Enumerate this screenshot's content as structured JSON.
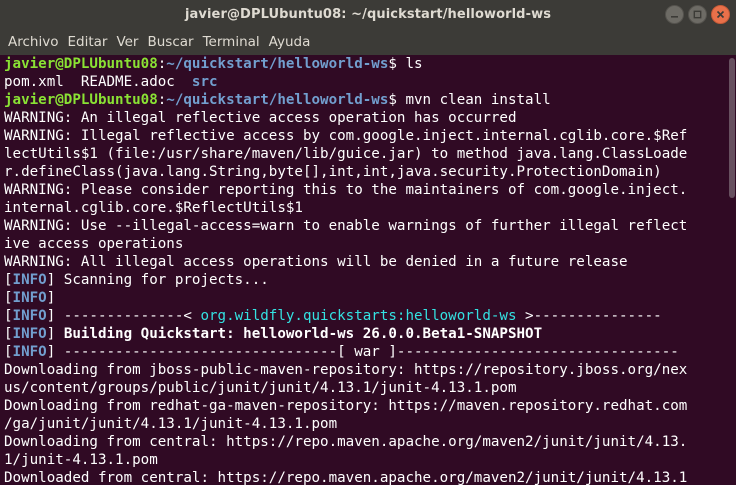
{
  "window": {
    "title": "javier@DPLUbuntu08: ~/quickstart/helloworld-ws",
    "controls": [
      "minimize-icon",
      "maximize-icon",
      "close-icon"
    ]
  },
  "menu": [
    "Archivo",
    "Editar",
    "Ver",
    "Buscar",
    "Terminal",
    "Ayuda"
  ],
  "colors": {
    "terminal_bg": "#300a24",
    "titlebar_bg": "#3c3b37",
    "prompt_user": "#8ae234",
    "prompt_path": "#729fcf",
    "info_tag": "#729fcf",
    "artifact": "#34e2e2",
    "close_button": "#e9704a"
  },
  "terminal": {
    "prompt_user": "javier@DPLUbuntu08",
    "prompt_path": "~/quickstart/helloworld-ws",
    "lines": [
      [
        [
          "user",
          "javier@DPLUbuntu08"
        ],
        [
          "",
          ":"
        ],
        [
          "path",
          "~/quickstart/helloworld-ws"
        ],
        [
          "",
          "$ ls"
        ]
      ],
      [
        [
          "",
          "pom.xml  README.adoc  "
        ],
        [
          "dir",
          "src"
        ]
      ],
      [
        [
          "user",
          "javier@DPLUbuntu08"
        ],
        [
          "",
          ":"
        ],
        [
          "path",
          "~/quickstart/helloworld-ws"
        ],
        [
          "",
          "$ mvn clean install"
        ]
      ],
      [
        [
          "",
          "WARNING: An illegal reflective access operation has occurred"
        ]
      ],
      [
        [
          "",
          "WARNING: Illegal reflective access by com.google.inject.internal.cglib.core.$Ref"
        ]
      ],
      [
        [
          "",
          "lectUtils$1 (file:/usr/share/maven/lib/guice.jar) to method java.lang.ClassLoade"
        ]
      ],
      [
        [
          "",
          "r.defineClass(java.lang.String,byte[],int,int,java.security.ProtectionDomain)"
        ]
      ],
      [
        [
          "",
          "WARNING: Please consider reporting this to the maintainers of com.google.inject."
        ]
      ],
      [
        [
          "",
          "internal.cglib.core.$ReflectUtils$1"
        ]
      ],
      [
        [
          "",
          "WARNING: Use --illegal-access=warn to enable warnings of further illegal reflect"
        ]
      ],
      [
        [
          "",
          "ive access operations"
        ]
      ],
      [
        [
          "",
          "WARNING: All illegal access operations will be denied in a future release"
        ]
      ],
      [
        [
          "",
          "["
        ],
        [
          "ib",
          "INFO"
        ],
        [
          "",
          "] Scanning for projects..."
        ]
      ],
      [
        [
          "",
          "["
        ],
        [
          "ib",
          "INFO"
        ],
        [
          "",
          "]"
        ]
      ],
      [
        [
          "",
          "["
        ],
        [
          "ib",
          "INFO"
        ],
        [
          "",
          "] --------------< "
        ],
        [
          "teal",
          "org.wildfly.quickstarts:helloworld-ws"
        ],
        [
          "",
          " >---------------"
        ]
      ],
      [
        [
          "",
          "["
        ],
        [
          "ib",
          "INFO"
        ],
        [
          "",
          "] "
        ],
        [
          "b",
          "Building Quickstart: helloworld-ws 26.0.0.Beta1-SNAPSHOT"
        ]
      ],
      [
        [
          "",
          "["
        ],
        [
          "ib",
          "INFO"
        ],
        [
          "",
          "] --------------------------------[ war ]---------------------------------"
        ]
      ],
      [
        [
          "",
          "Downloading from jboss-public-maven-repository: https://repository.jboss.org/nex"
        ]
      ],
      [
        [
          "",
          "us/content/groups/public/junit/junit/4.13.1/junit-4.13.1.pom"
        ]
      ],
      [
        [
          "",
          "Downloading from redhat-ga-maven-repository: https://maven.repository.redhat.com"
        ]
      ],
      [
        [
          "",
          "/ga/junit/junit/4.13.1/junit-4.13.1.pom"
        ]
      ],
      [
        [
          "",
          "Downloading from central: https://repo.maven.apache.org/maven2/junit/junit/4.13."
        ]
      ],
      [
        [
          "",
          "1/junit-4.13.1.pom"
        ]
      ],
      [
        [
          "",
          "Downloaded from central: https://repo.maven.apache.org/maven2/junit/junit/4.13.1"
        ]
      ]
    ]
  }
}
